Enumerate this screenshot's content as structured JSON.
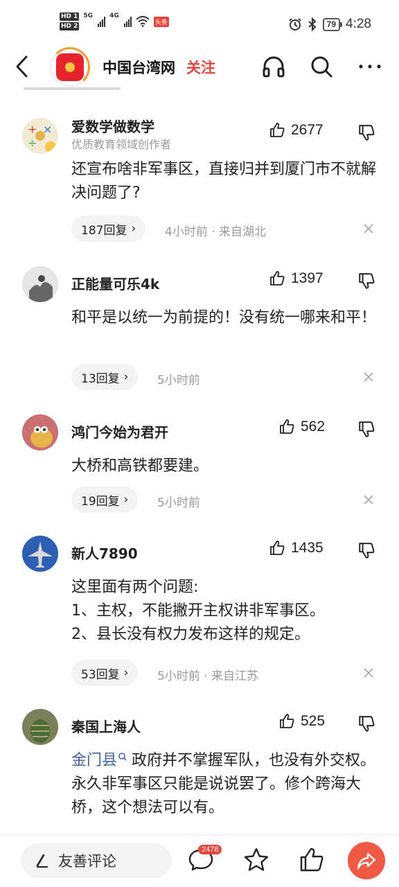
{
  "status_bar": {
    "hd1": "HD 1",
    "hd2": "HD 2",
    "net1": "5G",
    "net2": "4G",
    "app_badge": "头条",
    "battery": "79",
    "time": "4:28"
  },
  "header": {
    "site_name": "中国台湾网",
    "follow_label": "关注"
  },
  "comments": [
    {
      "author": "爱数学做数学",
      "subtitle": "优质教育领域创作者",
      "likes": "2677",
      "text": "还宣布啥非军事区，直接归并到厦门市不就解决问题了?",
      "replies": "187回复",
      "meta": "4小时前 · 来自湖北"
    },
    {
      "author": "正能量可乐4k",
      "likes": "1397",
      "text": "和平是以统一为前提的！没有统一哪来和平！",
      "replies": "13回复",
      "meta": "5小时前"
    },
    {
      "author": "鸿门今始为君开",
      "likes": "562",
      "text": "大桥和高铁都要建。",
      "replies": "19回复",
      "meta": "5小时前"
    },
    {
      "author": "新人7890",
      "likes": "1435",
      "text_lines": [
        "这里面有两个问题:",
        "1、主权，不能撇开主权讲非军事区。",
        "2、县长没有权力发布这样的规定。"
      ],
      "replies": "53回复",
      "meta": "5小时前 · 来自江苏"
    },
    {
      "author": "秦国上海人",
      "likes": "525",
      "link": "金门县",
      "text": "政府并不掌握军队，也没有外交权。永久非军事区只能是说说罢了。修个跨海大桥，这个想法可以有。"
    }
  ],
  "bottom_bar": {
    "input_label": "友善评论",
    "comment_count": "2478"
  },
  "colors": {
    "accent_red": "#e8453c",
    "link_blue": "#406599",
    "meta_gray": "#999999",
    "share_orange": "#f05a45"
  },
  "icons": [
    "back-icon",
    "headphones-icon",
    "search-icon",
    "more-icon",
    "thumb-up-icon",
    "thumb-down-icon",
    "close-icon",
    "pen-icon",
    "comment-icon",
    "star-icon",
    "share-icon"
  ]
}
